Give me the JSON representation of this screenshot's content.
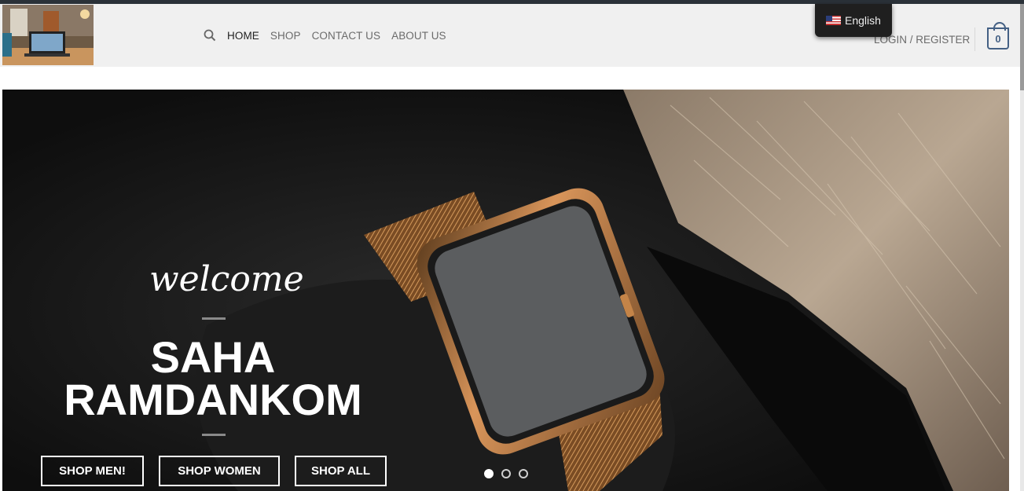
{
  "header": {
    "logo_alt": "",
    "nav": [
      {
        "label": "HOME",
        "active": true
      },
      {
        "label": "SHOP",
        "active": false
      },
      {
        "label": "CONTACT US",
        "active": false
      },
      {
        "label": "ABOUT US",
        "active": false
      }
    ],
    "login_label": "LOGIN / REGISTER",
    "cart_count": "0",
    "language": "English"
  },
  "hero": {
    "welcome": "welcome",
    "title_line1": "SAHA",
    "title_line2": "RAMDANKOM",
    "buttons": [
      "SHOP MEN!",
      "SHOP WOMEN",
      "SHOP ALL"
    ],
    "slides_total": 3,
    "slide_active": 1
  },
  "colors": {
    "accent": "#446084",
    "header_bg": "#f0f0f0",
    "topbar": "#2a3138"
  }
}
